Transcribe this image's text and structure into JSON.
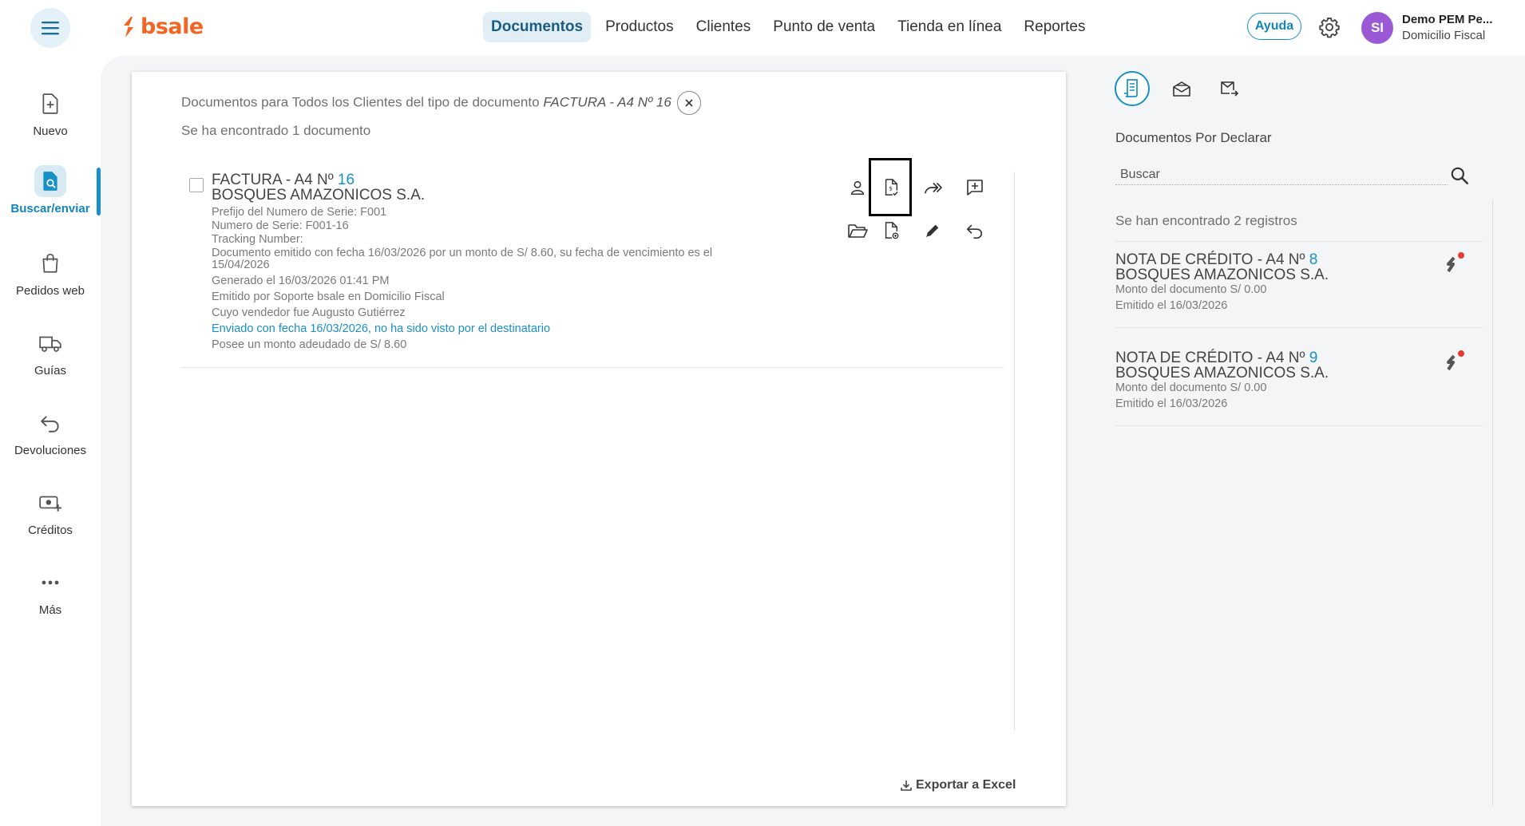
{
  "brand": {
    "name": "bsale",
    "accent": "#f26522",
    "primary": "#1791c7"
  },
  "header": {
    "nav": [
      "Documentos",
      "Productos",
      "Clientes",
      "Punto de venta",
      "Tienda en línea",
      "Reportes"
    ],
    "active_nav": "Documentos",
    "help_label": "Ayuda",
    "avatar_initials": "SI",
    "user_name": "Demo PEM Pe...",
    "user_branch": "Domicilio Fiscal"
  },
  "sidebar": {
    "items": [
      {
        "label": "Nuevo",
        "icon": "new-document-icon"
      },
      {
        "label": "Buscar/enviar",
        "icon": "search-document-icon",
        "active": true
      },
      {
        "label": "Pedidos web",
        "icon": "shopping-bag-icon"
      },
      {
        "label": "Guías",
        "icon": "truck-icon"
      },
      {
        "label": "Devoluciones",
        "icon": "return-arrow-icon"
      },
      {
        "label": "Créditos",
        "icon": "credit-money-icon"
      },
      {
        "label": "Más",
        "icon": "more-dots-icon"
      }
    ]
  },
  "main": {
    "criteria_prefix": "Documentos para Todos los Clientes del tipo de documento",
    "criteria_doc_type": "FACTURA - A4",
    "criteria_number": "Nº 16",
    "found_text": "Se ha encontrado 1 documento",
    "document": {
      "type_label": "FACTURA - A4 Nº",
      "number": "16",
      "client": "BOSQUES AMAZONICOS S.A.",
      "details": [
        "Prefijo del Numero de Serie: F001",
        "Numero de Serie: F001-16",
        "Tracking Number:",
        "Documento emitido con fecha 16/03/2026 por un monto de S/ 8.60, su fecha de vencimiento es el",
        "15/04/2026",
        "Generado el 16/03/2026 01:41 PM",
        "Emitido por Soporte bsale en Domicilio Fiscal",
        "Cuyo vendedor fue Augusto Gutiérrez"
      ],
      "sent_status": "Enviado con fecha 16/03/2026, no ha sido visto por el destinatario",
      "balance": "Posee un monto adeudado de S/ 8.60",
      "actions": [
        "client-icon",
        "tax-document-icon",
        "forward-icon",
        "add-comment-icon",
        "folder-icon",
        "attach-document-icon",
        "edit-pencil-icon",
        "undo-return-icon"
      ]
    },
    "export_label": "Exportar a Excel"
  },
  "right_panel": {
    "tabs": [
      "document-list-icon",
      "mailbox-icon",
      "mail-send-icon"
    ],
    "title": "Documentos Por Declarar",
    "search_placeholder": "Buscar",
    "found_text": "Se han encontrado 2 registros",
    "items": [
      {
        "type_label": "NOTA DE CRÉDITO - A4 Nº",
        "number": "8",
        "client": "BOSQUES AMAZONICOS S.A.",
        "amount": "Monto del documento S/ 0.00",
        "issued": "Emitido el 16/03/2026"
      },
      {
        "type_label": "NOTA DE CRÉDITO - A4 Nº",
        "number": "9",
        "client": "BOSQUES AMAZONICOS S.A.",
        "amount": "Monto del documento S/ 0.00",
        "issued": "Emitido el 16/03/2026"
      }
    ]
  }
}
